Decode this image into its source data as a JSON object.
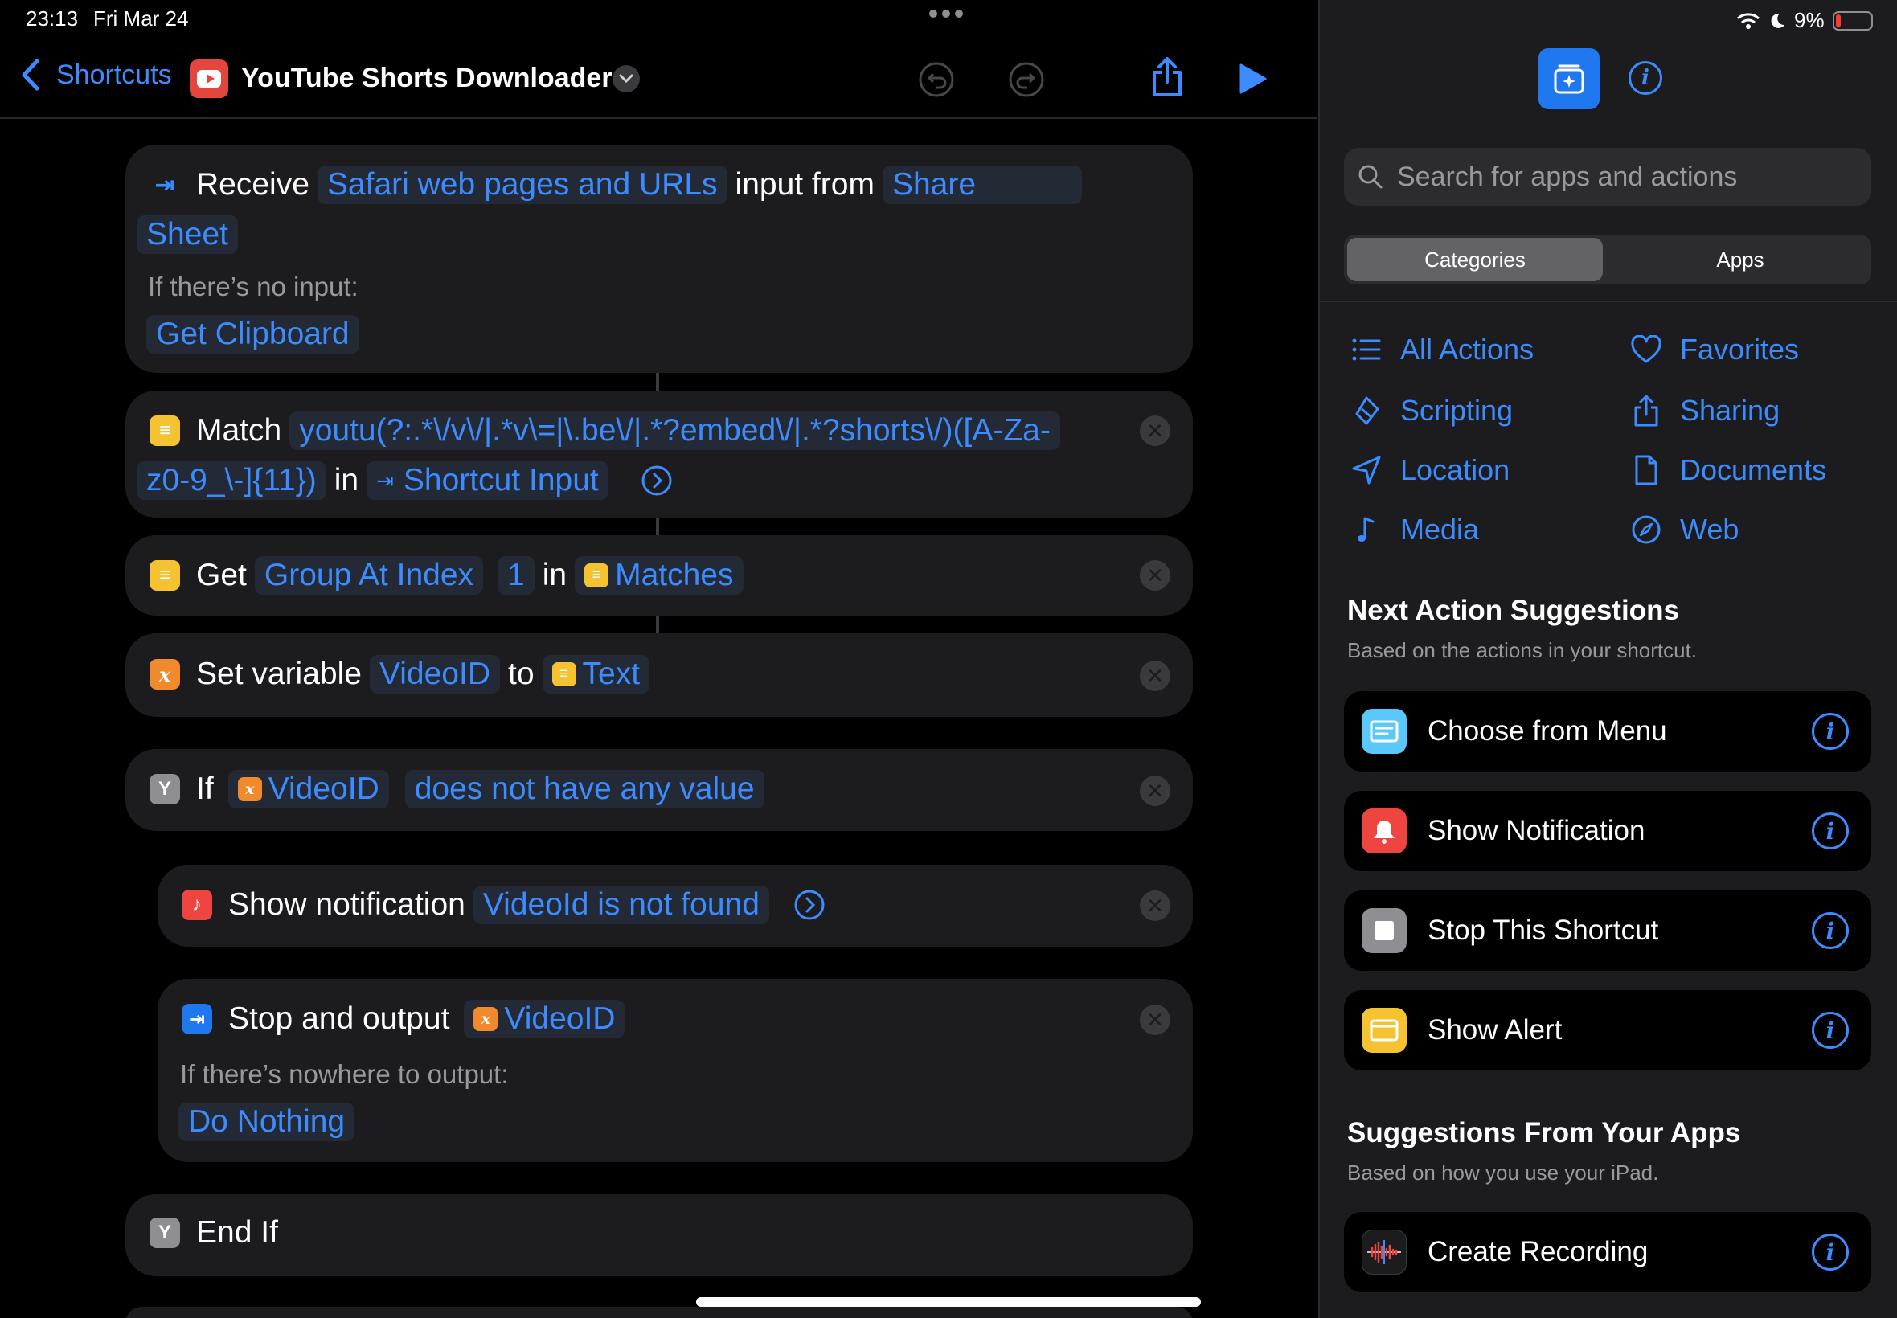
{
  "status_bar": {
    "time": "23:13",
    "date": "Fri Mar 24",
    "battery": "9%"
  },
  "nav": {
    "back_label": "Shortcuts",
    "title": "YouTube Shorts Downloader"
  },
  "actions": {
    "receive": {
      "verb": "Receive",
      "input_type_line1": "Safari web pages and URLs",
      "middle": "input from",
      "source_part1": "Share",
      "source_part2": "Sheet",
      "no_input_label": "If there’s no input:",
      "no_input_action": "Get Clipboard"
    },
    "match": {
      "verb": "Match",
      "pattern_line1": "youtu(?:.*\\/v\\/|.*v\\=|\\.be\\/|.*?embed\\/|.*?shorts\\/)([A-Za-",
      "pattern_line2": "z0-9_\\-]{11})",
      "in": "in",
      "input": "Shortcut Input"
    },
    "get_group": {
      "verb": "Get",
      "what": "Group At Index",
      "index": "1",
      "in": "in",
      "source": "Matches"
    },
    "set_variable": {
      "verb": "Set variable",
      "name": "VideoID",
      "to": "to",
      "value": "Text"
    },
    "if": {
      "verb": "If",
      "variable": "VideoID",
      "condition": "does not have any value"
    },
    "show_notification": {
      "verb": "Show notification",
      "message": "VideoId is not found"
    },
    "stop_output": {
      "verb": "Stop and output",
      "value": "VideoID",
      "nowhere_label": "If there’s nowhere to output:",
      "nowhere_action": "Do Nothing"
    },
    "end_if": {
      "verb": "End If"
    }
  },
  "sidebar": {
    "search_placeholder": "Search for apps and actions",
    "segments": [
      "Categories",
      "Apps"
    ],
    "categories": [
      {
        "label": "All Actions",
        "icon": "list-icon"
      },
      {
        "label": "Favorites",
        "icon": "heart-icon"
      },
      {
        "label": "Scripting",
        "icon": "scripting-icon"
      },
      {
        "label": "Sharing",
        "icon": "share-icon"
      },
      {
        "label": "Location",
        "icon": "location-arrow-icon"
      },
      {
        "label": "Documents",
        "icon": "document-icon"
      },
      {
        "label": "Media",
        "icon": "music-note-icon"
      },
      {
        "label": "Web",
        "icon": "compass-icon"
      }
    ],
    "next_suggestions": {
      "title": "Next Action Suggestions",
      "subtitle": "Based on the actions in your shortcut.",
      "items": [
        {
          "label": "Choose from Menu",
          "icon": "menu-icon"
        },
        {
          "label": "Show Notification",
          "icon": "notification-icon"
        },
        {
          "label": "Stop This Shortcut",
          "icon": "stop-icon"
        },
        {
          "label": "Show Alert",
          "icon": "alert-icon"
        }
      ]
    },
    "app_suggestions": {
      "title": "Suggestions From Your Apps",
      "subtitle": "Based on how you use your iPad.",
      "items": [
        {
          "label": "Create Recording",
          "icon": "voice-memo-icon"
        }
      ]
    }
  },
  "colors": {
    "accent": "#3c8bff",
    "card": "#1c1c1e",
    "background": "#000000"
  }
}
